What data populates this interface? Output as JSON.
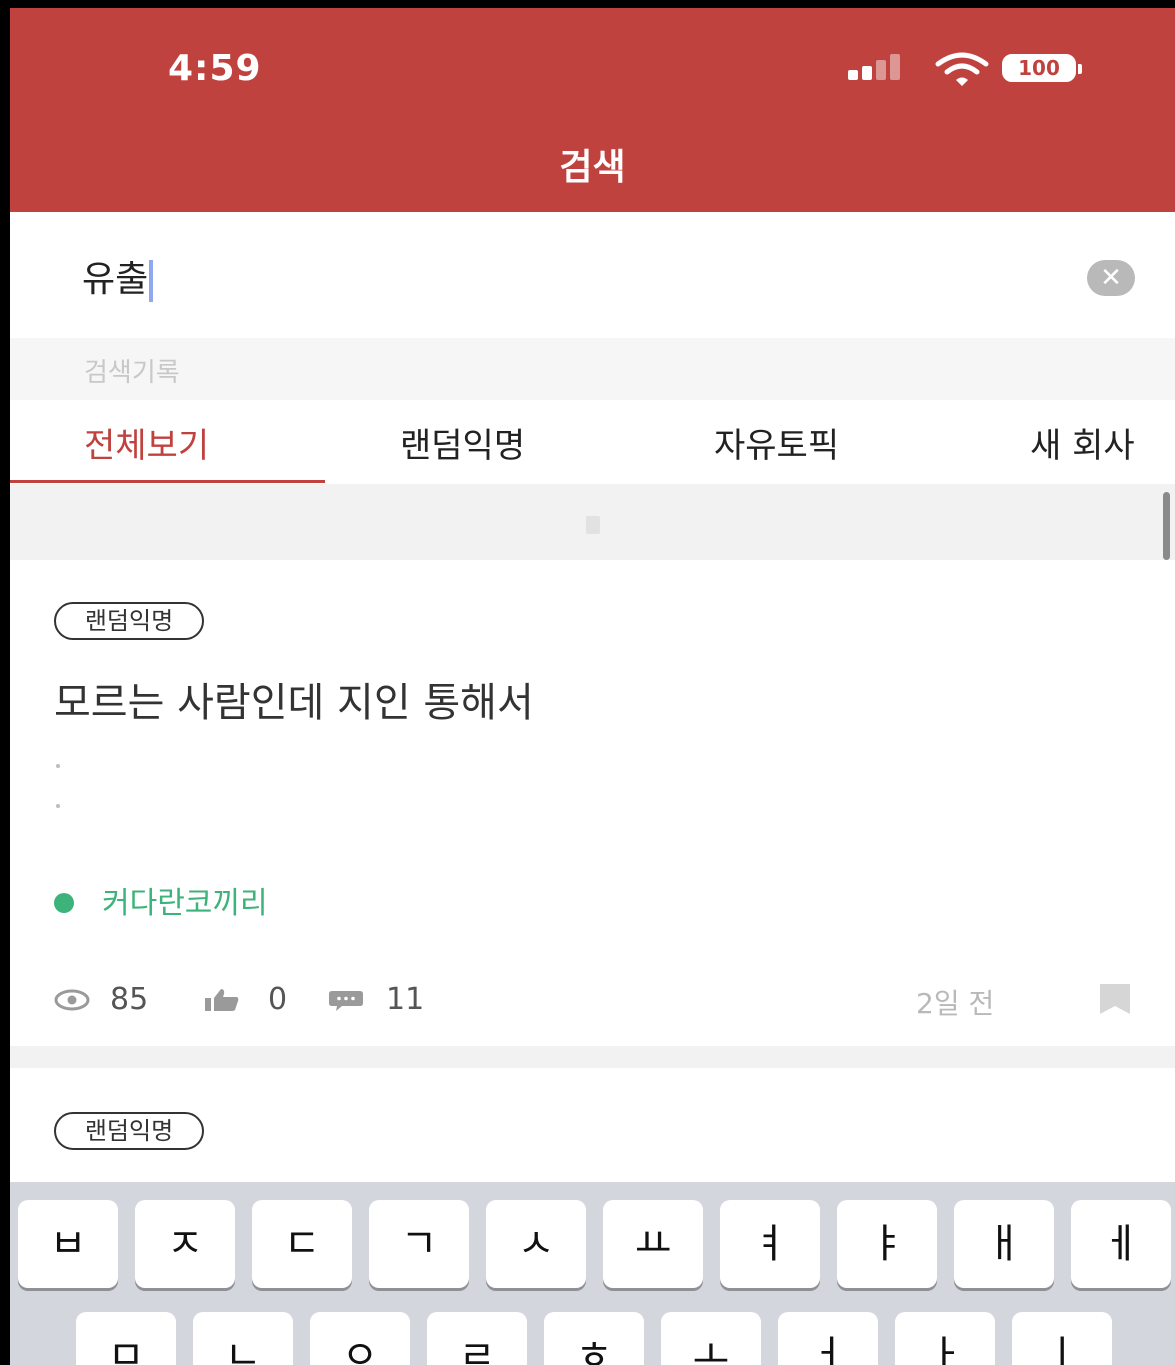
{
  "status_bar": {
    "time": "4:59",
    "battery": "100"
  },
  "header": {
    "title": "검색"
  },
  "search": {
    "value": "유출",
    "clear_icon": "clear-icon"
  },
  "history": {
    "label": "검색기록"
  },
  "tabs": [
    {
      "label": "전체보기",
      "active": true
    },
    {
      "label": "랜덤익명"
    },
    {
      "label": "자유토픽"
    },
    {
      "label": "새 회사"
    }
  ],
  "posts": [
    {
      "category": "랜덤익명",
      "title": "모르는 사람인데 지인 통해서",
      "author": "커다란코끼리",
      "views": "85",
      "likes": "0",
      "comments": "11",
      "time_ago": "2일 전"
    },
    {
      "category": "랜덤익명"
    }
  ],
  "keyboard": {
    "row1": [
      "ㅂ",
      "ㅈ",
      "ㄷ",
      "ㄱ",
      "ㅅ",
      "ㅛ",
      "ㅕ",
      "ㅑ",
      "ㅐ",
      "ㅔ"
    ],
    "row2": [
      "ㅁ",
      "ㄴ",
      "ㅇ",
      "ㄹ",
      "ㅎ",
      "ㅗ",
      "ㅓ",
      "ㅏ",
      "ㅣ"
    ]
  },
  "colors": {
    "brand": "#c0423f",
    "author_green": "#3cb37a"
  }
}
